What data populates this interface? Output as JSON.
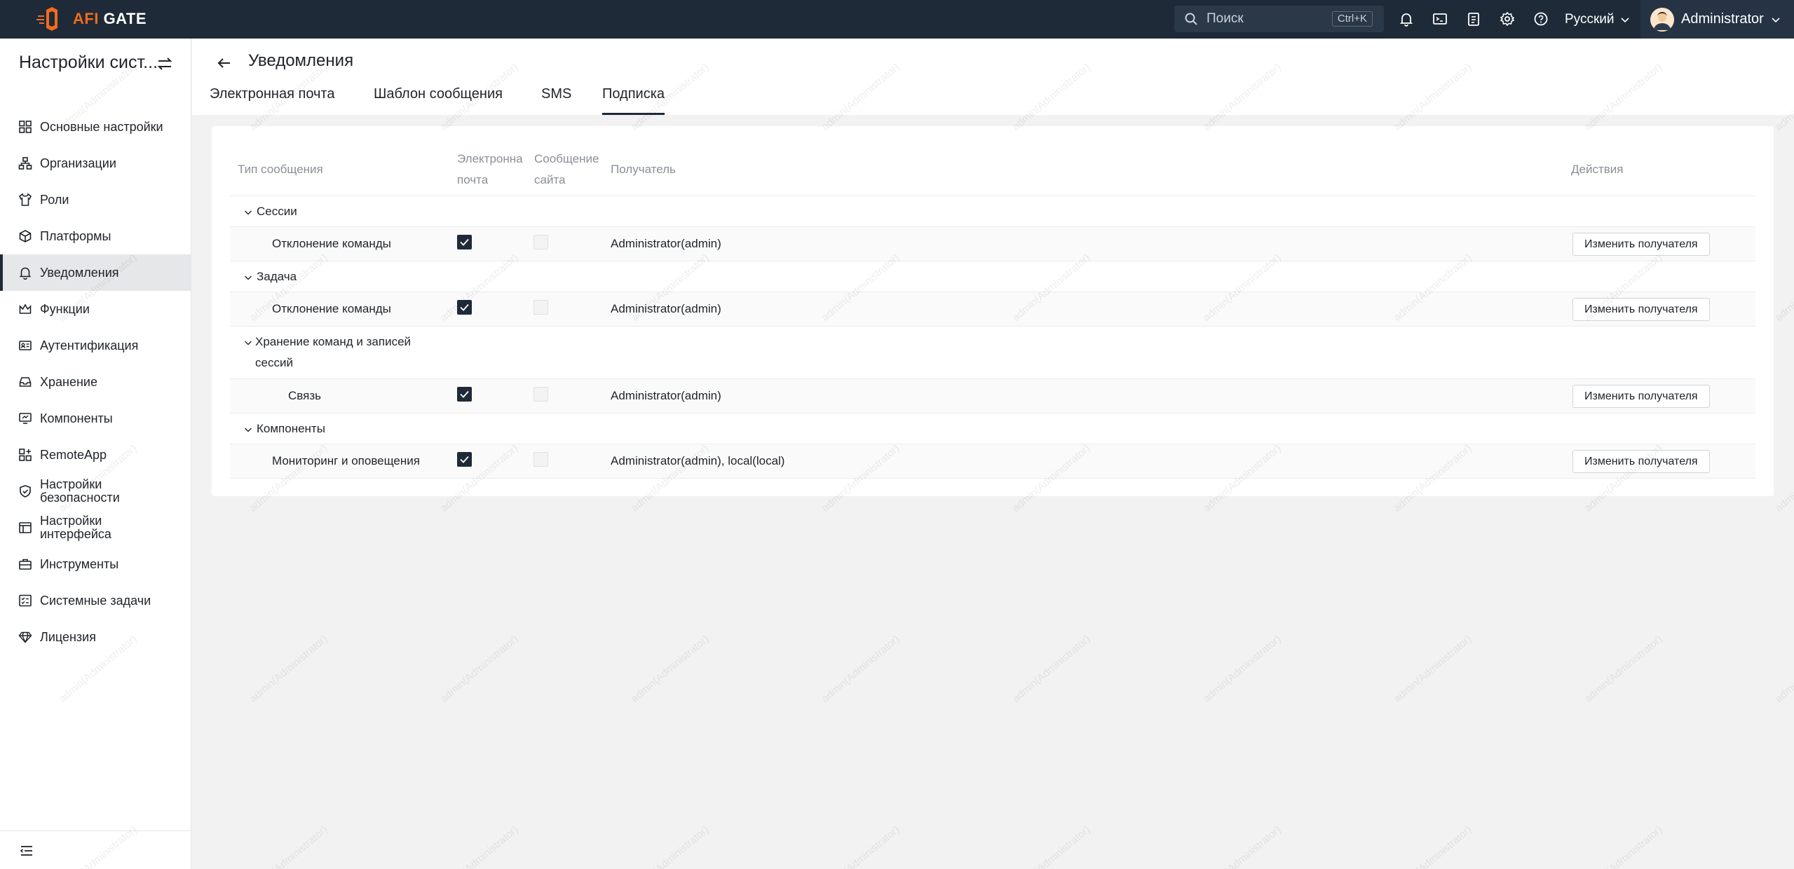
{
  "brand": {
    "logo_text_a": "AFI",
    "logo_text_b": " GATE",
    "accent": "#f26b1d",
    "header_bg": "#1e2a38"
  },
  "topbar": {
    "search_placeholder": "Поиск",
    "search_shortcut": "Ctrl+K",
    "icons": [
      "bell-icon",
      "terminal-icon",
      "clipboard-icon",
      "gear-icon",
      "help-icon"
    ],
    "language": "Русский",
    "user_name": "Administrator"
  },
  "sidebar": {
    "title": "Настройки сист...",
    "items": [
      {
        "label": "Основные настройки",
        "icon": "grid-icon"
      },
      {
        "label": "Организации",
        "icon": "org-icon"
      },
      {
        "label": "Роли",
        "icon": "shirt-icon"
      },
      {
        "label": "Платформы",
        "icon": "cube-icon"
      },
      {
        "label": "Уведомления",
        "icon": "bell-icon",
        "active": true
      },
      {
        "label": "Функции",
        "icon": "crown-icon"
      },
      {
        "label": "Аутентификация",
        "icon": "id-card-icon"
      },
      {
        "label": "Хранение",
        "icon": "inbox-icon"
      },
      {
        "label": "Компоненты",
        "icon": "monitor-icon"
      },
      {
        "label": "RemoteApp",
        "icon": "apps-icon"
      },
      {
        "label": "Настройки безопасности",
        "icon": "shield-icon"
      },
      {
        "label": "Настройки интерфейса",
        "icon": "layout-icon"
      },
      {
        "label": "Инструменты",
        "icon": "toolbox-icon"
      },
      {
        "label": "Системные задачи",
        "icon": "tasks-icon"
      },
      {
        "label": "Лицензия",
        "icon": "diamond-icon"
      }
    ]
  },
  "page": {
    "title": "Уведомления",
    "tabs": [
      "Электронная почта",
      "Шаблон сообщения",
      "SMS",
      "Подписка"
    ],
    "active_tab": "Подписка"
  },
  "table": {
    "headers": {
      "type": "Тип сообщения",
      "email_1": "Электронна",
      "email_2": "почта",
      "site_1": "Сообщение",
      "site_2": "сайта",
      "recipient": "Получатель",
      "actions": "Действия"
    },
    "groups": [
      {
        "name": "Сессии",
        "rows": [
          {
            "name": "Отклонение команды",
            "email": true,
            "site": false,
            "recipient": "Administrator(admin)",
            "action": "Изменить получателя"
          }
        ]
      },
      {
        "name": "Задача",
        "rows": [
          {
            "name": "Отклонение команды",
            "email": true,
            "site": false,
            "recipient": "Administrator(admin)",
            "action": "Изменить получателя"
          }
        ]
      },
      {
        "name_1": "Хранение команд и записей",
        "name_2": "сессий",
        "rows": [
          {
            "name": "Связь",
            "email": true,
            "site": false,
            "recipient": "Administrator(admin)",
            "action": "Изменить получателя"
          }
        ]
      },
      {
        "name": "Компоненты",
        "rows": [
          {
            "name": "Мониторинг и оповещения",
            "email": true,
            "site": false,
            "recipient": "Administrator(admin), local(local)",
            "action": "Изменить получателя"
          }
        ]
      }
    ]
  },
  "watermark": "admin(Administrator)"
}
